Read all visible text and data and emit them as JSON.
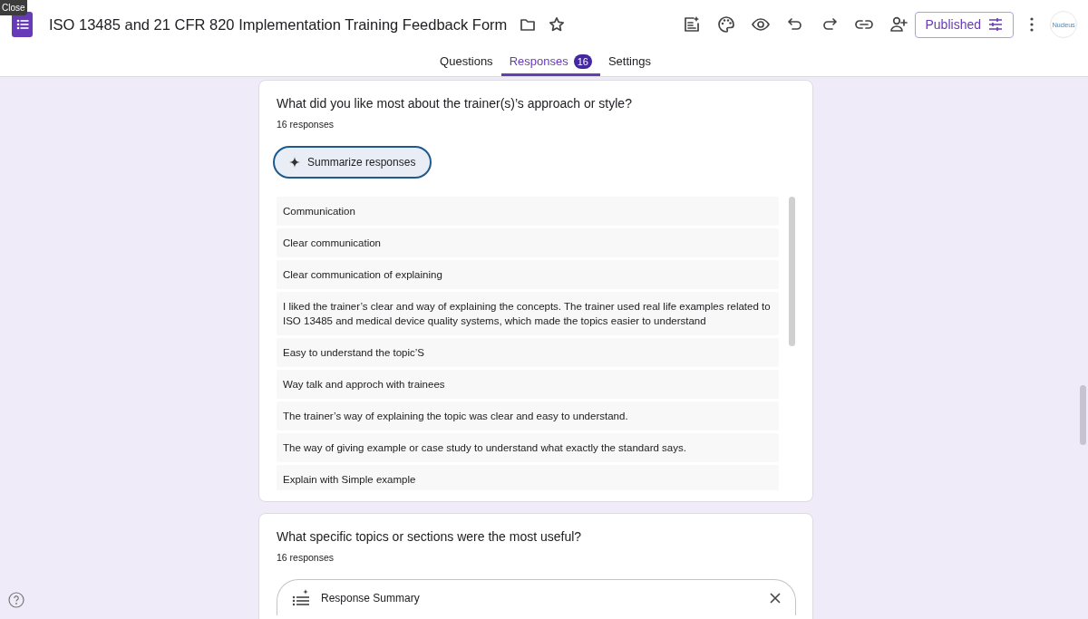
{
  "tooltip": "Close",
  "form": {
    "title": "ISO 13485 and 21 CFR 820 Implementation Training Feedback Form",
    "published_label": "Published",
    "avatar_text": "Nucleus"
  },
  "tabs": [
    {
      "label": "Questions",
      "selected": false
    },
    {
      "label": "Responses",
      "selected": true,
      "count": "16"
    },
    {
      "label": "Settings",
      "selected": false
    }
  ],
  "questions": [
    {
      "kind": "list",
      "title": "What did you like most about the trainer(s)’s approach or style?",
      "response_count": "16 responses",
      "summarize_label": "Summarize responses",
      "responses": [
        "Communication",
        "Clear communication",
        "Clear communication of explaining",
        "I liked the trainer’s clear and way of explaining the concepts. The trainer used real life examples related to ISO 13485 and medical device quality systems, which made the topics easier to understand",
        "Easy to understand the topic’S",
        "Way talk and approch with trainees",
        "The trainer’s way of explaining the topic was clear and easy to understand.",
        "The way of giving example or case study to understand what exactly the standard says.",
        "Explain with Simple example"
      ]
    },
    {
      "kind": "summary",
      "title": "What specific topics or sections were the most useful?",
      "response_count": "16 responses",
      "summary_title": "Response Summary"
    }
  ]
}
